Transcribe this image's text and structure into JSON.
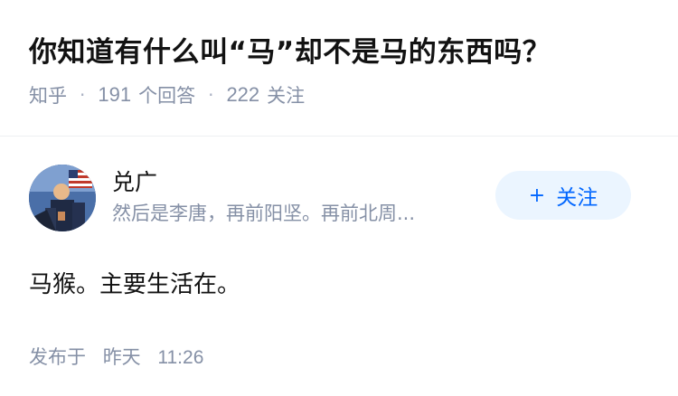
{
  "question": {
    "title": "你知道有什么叫“马”却不是马的东西吗？",
    "source": "知乎",
    "answer_count": "191",
    "answer_label": "个回答",
    "follower_count": "222",
    "follower_label": "关注",
    "separator": "·"
  },
  "answer": {
    "author_name": "兑广",
    "author_bio": "然后是李唐，再前阳坚。再前北周...",
    "follow_button": {
      "icon": "plus-icon",
      "label": "关注"
    },
    "content": "马猴。主要生活在。",
    "published_label": "发布于",
    "published_day": "昨天",
    "published_time": "11:26"
  },
  "colors": {
    "meta_text": "#8590a6",
    "follow_bg": "#ebf5ff",
    "follow_text": "#0066ff",
    "title_text": "#121212"
  }
}
